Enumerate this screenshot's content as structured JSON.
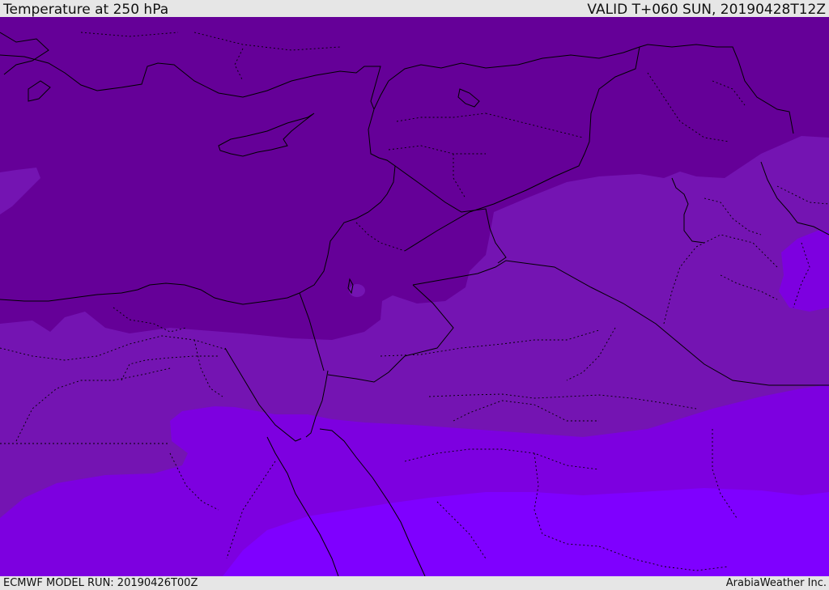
{
  "header": {
    "title": "Temperature at 250 hPa",
    "valid": "VALID T+060 SUN, 20190428T12Z"
  },
  "footer": {
    "model_run": "ECMWF MODEL RUN: 20190426T00Z",
    "credit": "ArabiaWeather Inc."
  },
  "colors": {
    "band_darkest": "#650098",
    "band_mid": "#7414b2",
    "band_violet": "#7d00e0",
    "band_bright": "#7f00ff",
    "coastline": "#000000",
    "borders": "#000000",
    "background": "#e6e6e6"
  }
}
